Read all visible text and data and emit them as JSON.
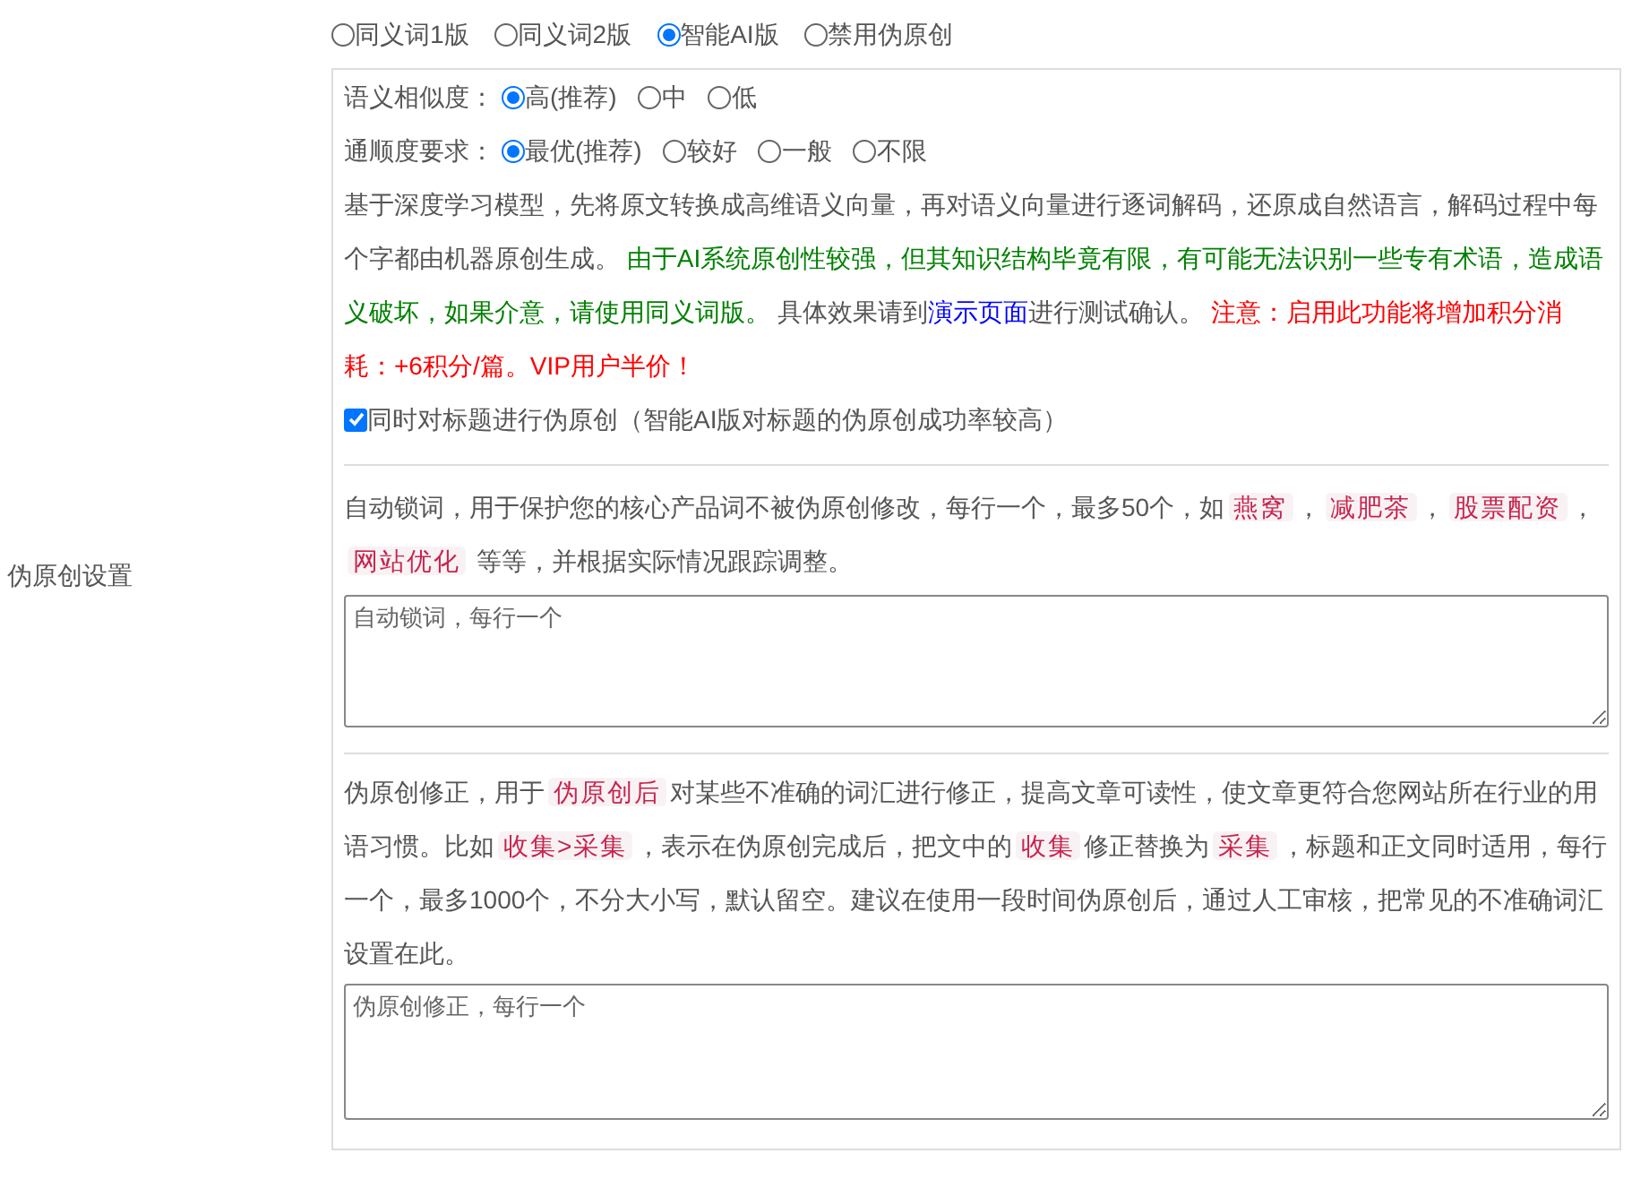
{
  "mode_options": [
    {
      "label": "同义词1版",
      "selected": false
    },
    {
      "label": "同义词2版",
      "selected": false
    },
    {
      "label": "智能AI版",
      "selected": true
    },
    {
      "label": "禁用伪原创",
      "selected": false
    }
  ],
  "settings_label": "伪原创设置",
  "ai_panel": {
    "similarity": {
      "label": "语义相似度：",
      "options": [
        {
          "label": "高(推荐)",
          "selected": true
        },
        {
          "label": "中",
          "selected": false
        },
        {
          "label": "低",
          "selected": false
        }
      ]
    },
    "fluency": {
      "label": "通顺度要求：",
      "options": [
        {
          "label": "最优(推荐)",
          "selected": true
        },
        {
          "label": "较好",
          "selected": false
        },
        {
          "label": "一般",
          "selected": false
        },
        {
          "label": "不限",
          "selected": false
        }
      ]
    },
    "description": [
      {
        "kind": "plain",
        "text": "基于深度学习模型，先将原文转换成高维语义向量，再对语义向量进行逐词解码，还原成自然语言，解码过程中每个字都由机器原创生成。 "
      },
      {
        "kind": "note",
        "text": "由于AI系统原创性较强，但其知识结构毕竟有限，有可能无法识别一些专有术语，造成语义破坏，如果介意，请使用同义词版。"
      },
      {
        "kind": "plain",
        "text": " 具体效果请到"
      },
      {
        "kind": "link",
        "text": "演示页面"
      },
      {
        "kind": "plain",
        "text": "进行测试确认。 "
      },
      {
        "kind": "warning",
        "text": "注意：启用此功能将增加积分消耗：+6积分/篇。VIP用户半价！"
      }
    ],
    "title_option": {
      "label": "同时对标题进行伪原创（智能AI版对标题的伪原创成功率较高）",
      "checked": true
    }
  },
  "lock_words": {
    "description": [
      {
        "kind": "plain",
        "text": "自动锁词，用于保护您的核心产品词不被伪原创修改，每行一个，最多50个，如"
      },
      {
        "kind": "tag",
        "text": "燕窝"
      },
      {
        "kind": "plain",
        "text": "，"
      },
      {
        "kind": "tag",
        "text": "减肥茶"
      },
      {
        "kind": "plain",
        "text": "，"
      },
      {
        "kind": "tag",
        "text": "股票配资"
      },
      {
        "kind": "plain",
        "text": "，"
      },
      {
        "kind": "tag",
        "text": "网站优化"
      },
      {
        "kind": "plain",
        "text": " 等等，并根据实际情况跟踪调整。"
      }
    ],
    "placeholder": "自动锁词，每行一个"
  },
  "correction": {
    "description": [
      {
        "kind": "plain",
        "text": "伪原创修正，用于"
      },
      {
        "kind": "tag",
        "text": "伪原创后"
      },
      {
        "kind": "plain",
        "text": "对某些不准确的词汇进行修正，提高文章可读性，使文章更符合您网站所在行业的用语习惯。比如"
      },
      {
        "kind": "tag",
        "text": "收集>采集"
      },
      {
        "kind": "plain",
        "text": "，表示在伪原创完成后，把文中的"
      },
      {
        "kind": "tag",
        "text": "收集"
      },
      {
        "kind": "plain",
        "text": "修正替换为"
      },
      {
        "kind": "tag",
        "text": "采集"
      },
      {
        "kind": "plain",
        "text": "，标题和正文同时适用，每行一个，最多1000个，不分大小写，默认留空。建议在使用一段时间伪原创后，通过人工审核，把常见的不准确词汇设置在此。"
      }
    ],
    "placeholder": "伪原创修正，每行一个"
  }
}
